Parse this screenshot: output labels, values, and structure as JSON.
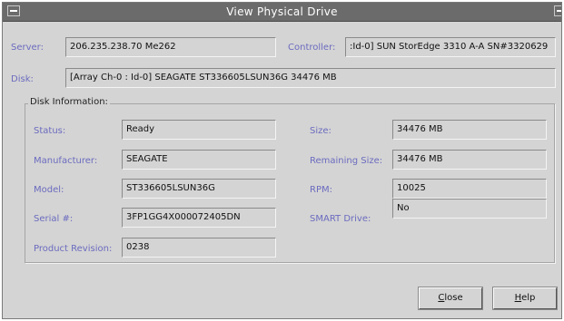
{
  "window": {
    "title": "View Physical Drive"
  },
  "server": {
    "label": "Server:",
    "value": "206.235.238.70 Me262"
  },
  "controller": {
    "label": "Controller:",
    "value": ":Id-0] SUN StorEdge 3310 A-A SN#3320629"
  },
  "disk": {
    "label": "Disk:",
    "value": "[Array Ch-0 : Id-0] SEAGATE ST336605LSUN36G 34476 MB"
  },
  "disk_info": {
    "title": "Disk Information:",
    "status": {
      "label": "Status:",
      "value": "Ready"
    },
    "manufacturer": {
      "label": "Manufacturer:",
      "value": "SEAGATE"
    },
    "model": {
      "label": "Model:",
      "value": "ST336605LSUN36G"
    },
    "serial": {
      "label": "Serial #:",
      "value": "3FP1GG4X000072405DN"
    },
    "product_revision": {
      "label": "Product Revision:",
      "value": "0238"
    },
    "size": {
      "label": "Size:",
      "value": "34476 MB"
    },
    "remaining_size": {
      "label": "Remaining Size:",
      "value": "34476 MB"
    },
    "rpm": {
      "label": "RPM:",
      "value": "10025"
    },
    "smart_drive": {
      "label": "SMART Drive:",
      "value": "No"
    }
  },
  "buttons": {
    "close": {
      "mnemonic": "C",
      "rest": "lose"
    },
    "help": {
      "mnemonic": "H",
      "rest": "elp"
    }
  }
}
